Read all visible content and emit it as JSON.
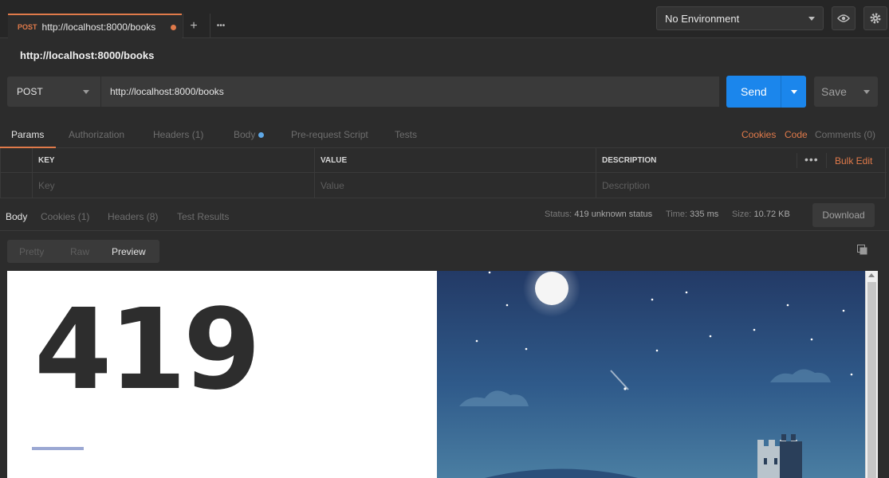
{
  "tab": {
    "method": "POST",
    "url": "http://localhost:8000/books"
  },
  "tab_actions": {
    "new_tab": "+",
    "more": "•••"
  },
  "environment": {
    "selected": "No Environment"
  },
  "request": {
    "title": "http://localhost:8000/books",
    "method": "POST",
    "url": "http://localhost:8000/books"
  },
  "actions": {
    "send": "Send",
    "save": "Save"
  },
  "request_tabs": [
    {
      "label": "Params"
    },
    {
      "label": "Authorization"
    },
    {
      "label": "Headers",
      "count": "(1)"
    },
    {
      "label": "Body"
    },
    {
      "label": "Pre-request Script"
    },
    {
      "label": "Tests"
    }
  ],
  "request_links": {
    "cookies": "Cookies",
    "code": "Code",
    "comments": "Comments (0)"
  },
  "params_table": {
    "headers": [
      "KEY",
      "VALUE",
      "DESCRIPTION"
    ],
    "placeholders": [
      "Key",
      "Value",
      "Description"
    ],
    "more": "•••",
    "bulk_edit": "Bulk Edit"
  },
  "response_tabs": [
    {
      "label": "Body"
    },
    {
      "label": "Cookies",
      "count": "(1)"
    },
    {
      "label": "Headers",
      "count": "(8)"
    },
    {
      "label": "Test Results"
    }
  ],
  "response_stats": {
    "status_label": "Status:",
    "status_value": "419 unknown status",
    "time_label": "Time:",
    "time_value": "335 ms",
    "size_label": "Size:",
    "size_value": "10.72 KB"
  },
  "download": "Download",
  "view_modes": [
    "Pretty",
    "Raw",
    "Preview"
  ],
  "preview": {
    "code": "419"
  },
  "colors": {
    "accent": "#e07a4a",
    "send": "#1b86ec",
    "sky_top": "#233a66",
    "sky_bottom": "#3d6d94"
  }
}
